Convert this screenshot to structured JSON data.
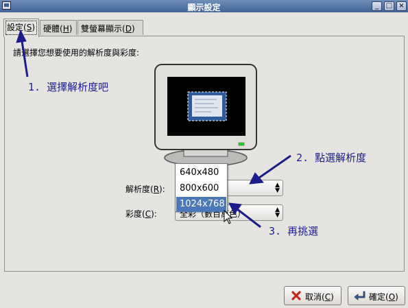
{
  "window": {
    "title": "顯示設定",
    "controls": {
      "minimize": "_",
      "maximize": "□",
      "close": "×"
    }
  },
  "tabs": [
    {
      "label": "設定",
      "mnemonic": "S"
    },
    {
      "label": "硬體",
      "mnemonic": "H"
    },
    {
      "label": "雙螢幕顯示",
      "mnemonic": "D"
    }
  ],
  "instruction": "請選擇您想要使用的解析度與彩度:",
  "resolution": {
    "label": "解析度",
    "mnemonic": "R",
    "options": [
      "640x480",
      "800x600",
      "1024x768"
    ],
    "selected": "1024x768"
  },
  "color_depth": {
    "label": "彩度",
    "mnemonic": "C",
    "value": "全彩（數百萬色）"
  },
  "buttons": {
    "cancel": {
      "label": "取消",
      "mnemonic": "C"
    },
    "ok": {
      "label": "確定",
      "mnemonic": "O"
    }
  },
  "annotations": {
    "step1": "1. 選擇解析度吧",
    "step2": "2. 點選解析度",
    "step3": "3. 再挑選"
  },
  "colors": {
    "annotation": "#1c1c8a",
    "selection": "#4a78b8",
    "titlebar": "#3f6496"
  }
}
